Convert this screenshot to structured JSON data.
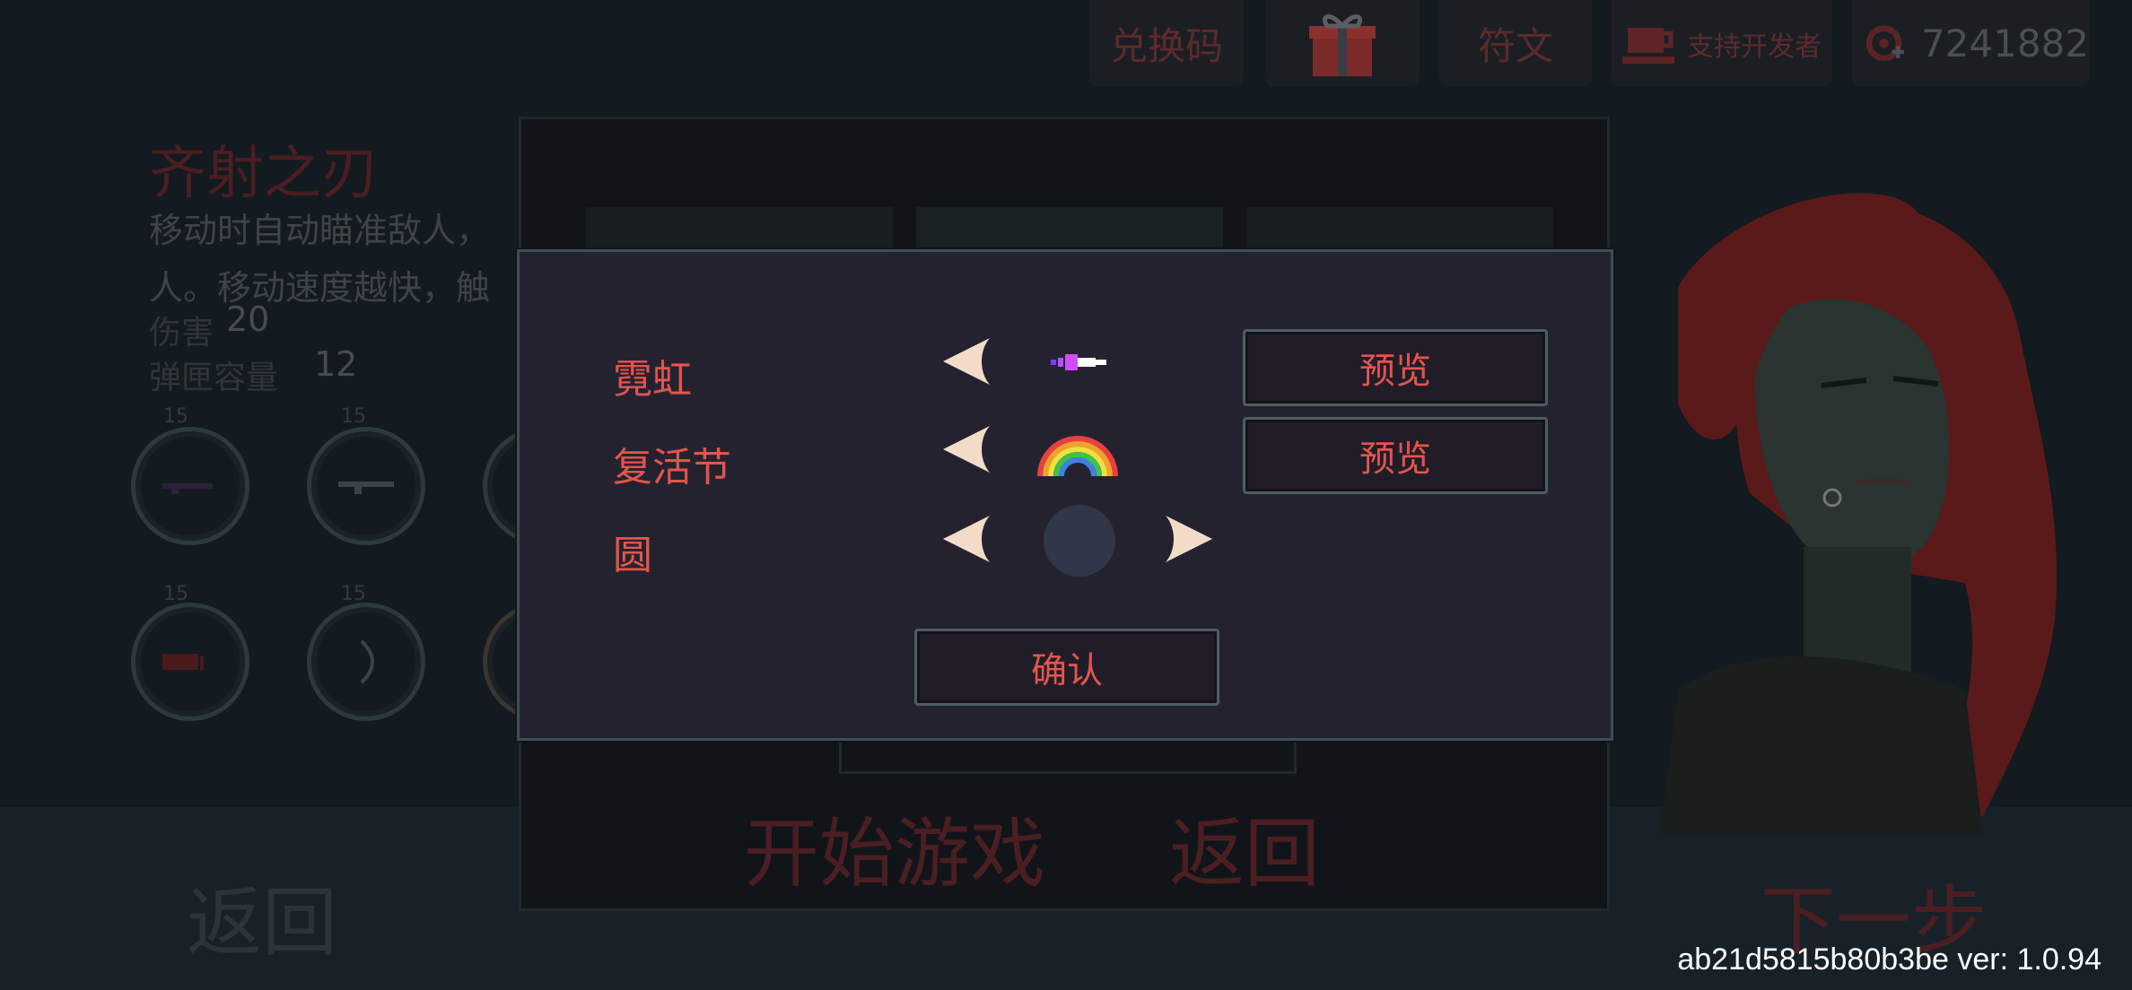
{
  "topbar": {
    "redeem_label": "兑换码",
    "gift_icon": "gift-icon",
    "runes_label": "符文",
    "support_label": "支持开发者",
    "currency_value": "7241882"
  },
  "weapon": {
    "name": "齐射之刃",
    "desc_line1": "移动时自动瞄准敌人，",
    "desc_line2": "人。移动速度越快，触",
    "damage_label": "伤害",
    "damage_value": "20",
    "ammo_label": "弹匣容量",
    "ammo_value": "12",
    "slot_levels": [
      "15",
      "15",
      "15",
      "15"
    ]
  },
  "background": {
    "start_label": "开始游戏",
    "return_label": "返回",
    "back_label": "返回",
    "next_label": "下一步"
  },
  "modal": {
    "rows": [
      {
        "label": "霓虹",
        "preview_label": "预览"
      },
      {
        "label": "复活节",
        "preview_label": "预览"
      },
      {
        "label": "圆"
      }
    ],
    "confirm_label": "确认"
  },
  "footer": {
    "version_text": "ab21d5815b80b3be ver: 1.0.94"
  },
  "colors": {
    "accent_red": "#e2554d",
    "arrow_fill": "#f2dcc8",
    "modal_bg": "#252230"
  }
}
